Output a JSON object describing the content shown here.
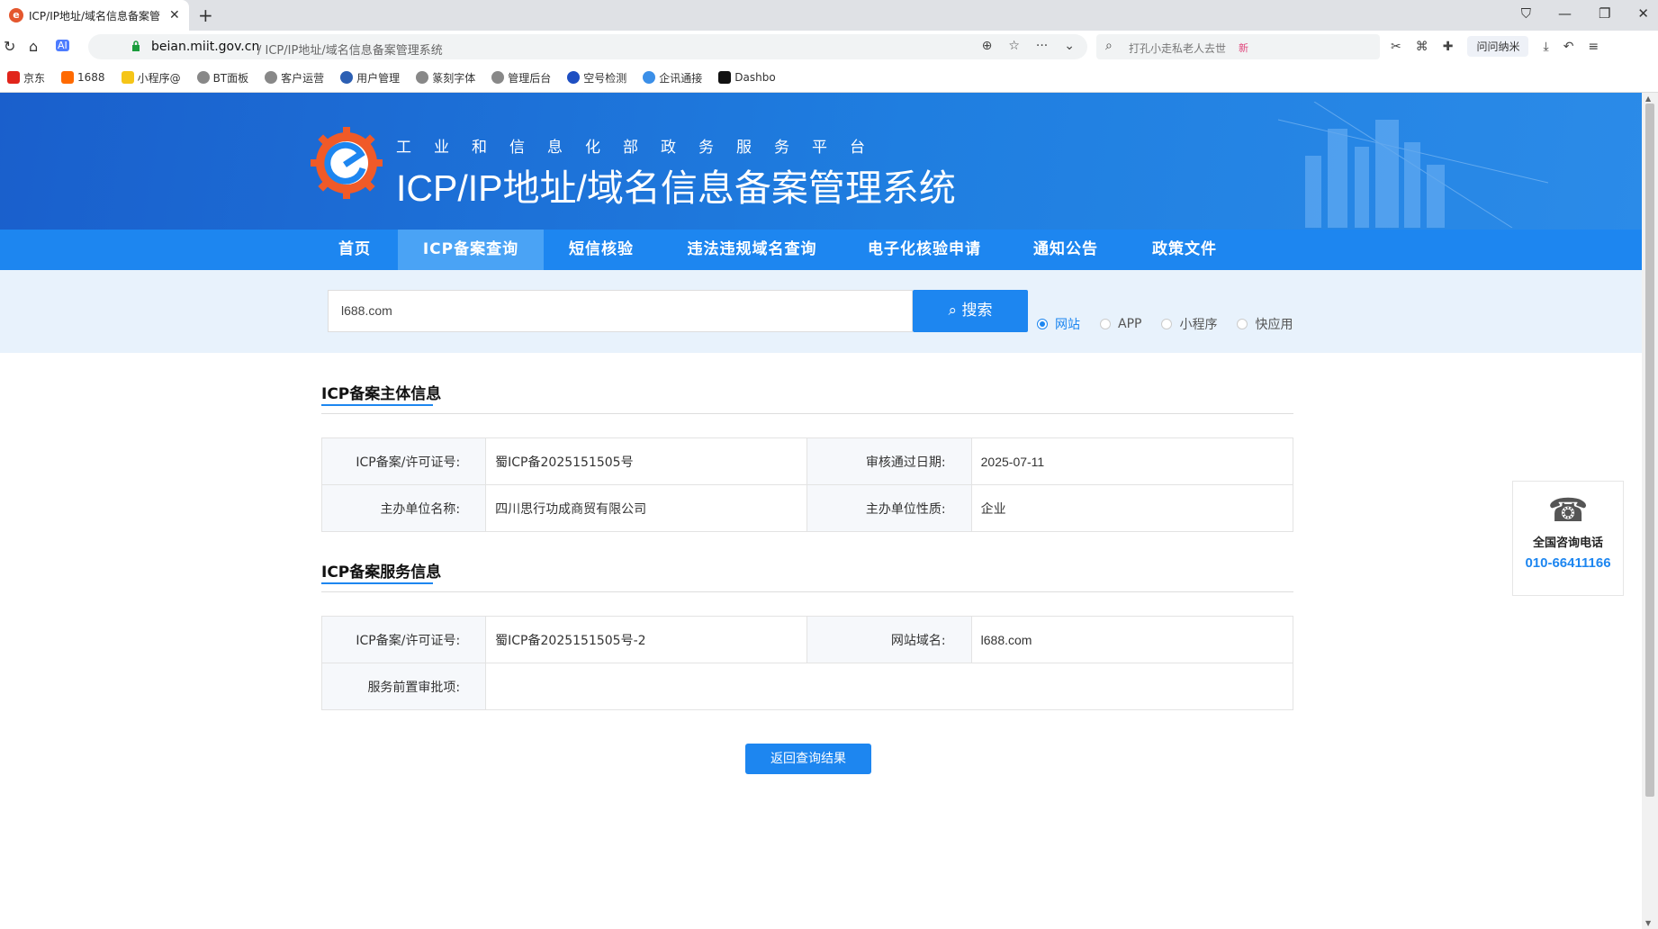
{
  "browser": {
    "tab_title": "ICP/IP地址/域名信息备案管",
    "url_host": "beian.miit.gov.cn",
    "url_path": "/ ICP/IP地址/域名信息备案管理系统",
    "search_placeholder": "打孔小走私老人去世",
    "search_badge": "新",
    "ext_label": "问问纳米",
    "bookmarks": [
      "京东",
      "1688",
      "小程序@",
      "BT面板",
      "客户运营",
      "用户管理",
      "篆刻字体",
      "管理后台",
      "空号检测",
      "企讯通接",
      "Dashbo"
    ]
  },
  "header": {
    "subtitle": "工业和信息化部政务服务平台",
    "title": "ICP/IP地址/域名信息备案管理系统"
  },
  "nav": {
    "items": [
      "首页",
      "ICP备案查询",
      "短信核验",
      "违法违规域名查询",
      "电子化核验申请",
      "通知公告",
      "政策文件"
    ]
  },
  "search": {
    "value": "l688.com",
    "button": "搜索",
    "options": [
      "网站",
      "APP",
      "小程序",
      "快应用"
    ]
  },
  "entity": {
    "title": "ICP备案主体信息",
    "rows": [
      {
        "label1": "ICP备案/许可证号:",
        "value1": "蜀ICP备2025151505号",
        "label2": "审核通过日期:",
        "value2": "2025-07-11"
      },
      {
        "label1": "主办单位名称:",
        "value1": "四川思行功成商贸有限公司",
        "label2": "主办单位性质:",
        "value2": "企业"
      }
    ]
  },
  "service": {
    "title": "ICP备案服务信息",
    "rows": [
      {
        "label1": "ICP备案/许可证号:",
        "value1": "蜀ICP备2025151505号-2",
        "label2": "网站域名:",
        "value2": "l688.com"
      },
      {
        "label1": "服务前置审批项:",
        "value1": ""
      }
    ]
  },
  "back_button": "返回查询结果",
  "consult": {
    "label": "全国咨询电话",
    "phone": "010-66411166"
  },
  "colors": {
    "primary": "#1d86f0",
    "header_dark": "#1a5fcc",
    "search_band": "#e8f2fc"
  }
}
